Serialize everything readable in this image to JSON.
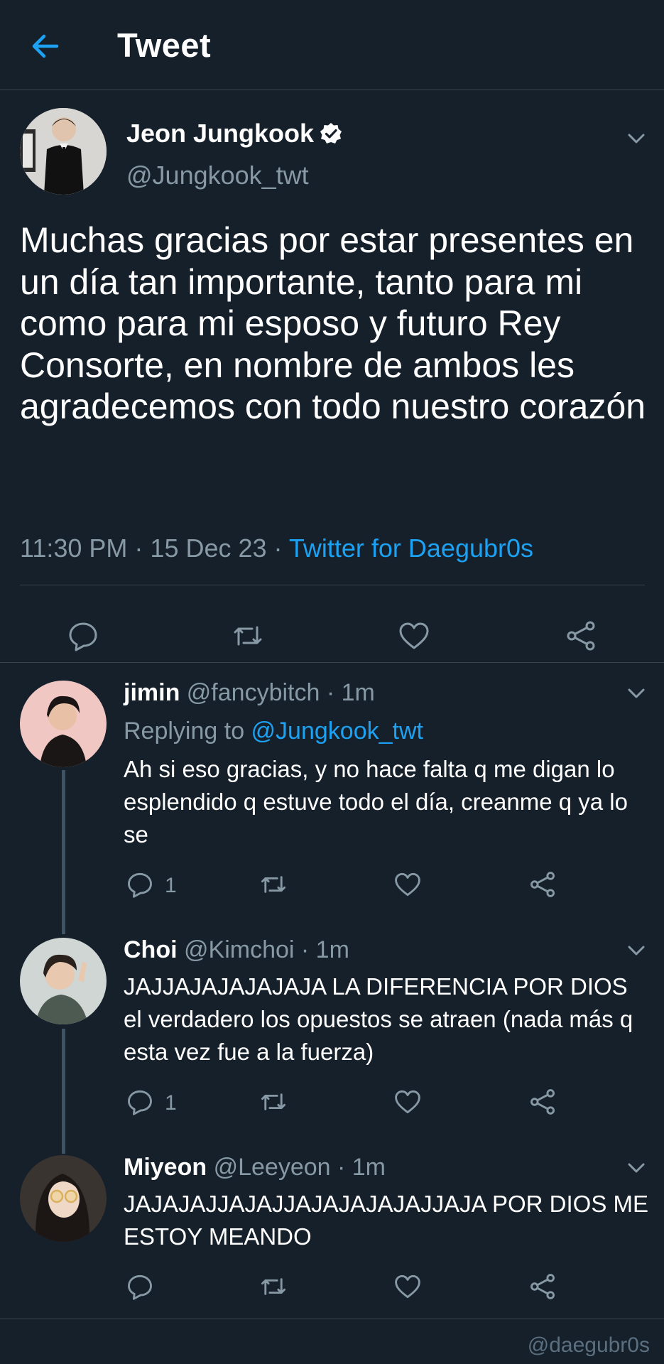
{
  "header": {
    "title": "Tweet",
    "back_icon": "arrow-left-icon"
  },
  "colors": {
    "background": "#15202b",
    "accent": "#1da1f2",
    "secondary_text": "#8899a6",
    "divider": "#38444d"
  },
  "tweet": {
    "name": "Jeon Jungkook",
    "handle": "@Jungkook_twt",
    "verified": true,
    "text": "Muchas gracias por estar presentes en un día tan importante, tanto para mi como para mi esposo y futuro Rey Consorte, en nombre de ambos les agradecemos con todo nuestro corazón",
    "time": "11:30 PM",
    "sep1": " · ",
    "date": "15 Dec 23",
    "sep2": " · ",
    "source": "Twitter for Daegubr0s",
    "actions": [
      "reply-icon",
      "retweet-icon",
      "like-icon",
      "share-icon"
    ]
  },
  "replies": [
    {
      "name": "jimin",
      "handle": "@fancybitch",
      "time": " · 1m",
      "replying_label": "Replying to ",
      "replying_handle": "@Jungkook_twt",
      "text": "Ah si eso gracias, y no hace falta q me digan lo esplendido q estuve todo el día, creanme q ya lo se",
      "reply_count": "1"
    },
    {
      "name": "Choi",
      "handle": "@Kimchoi",
      "time": " · 1m",
      "text": "JAJJAJAJAJAJAJA LA DIFERENCIA POR DIOS el verdadero los opuestos se atraen (nada más q esta vez fue a la fuerza)",
      "reply_count": "1"
    },
    {
      "name": "Miyeon",
      "handle": "@Leeyeon",
      "time": " · 1m",
      "text": "JAJAJAJJAJAJJAJAJAJAJAJJAJA POR DIOS ME ESTOY MEANDO",
      "reply_count": ""
    }
  ],
  "watermark": "@daegubr0s"
}
